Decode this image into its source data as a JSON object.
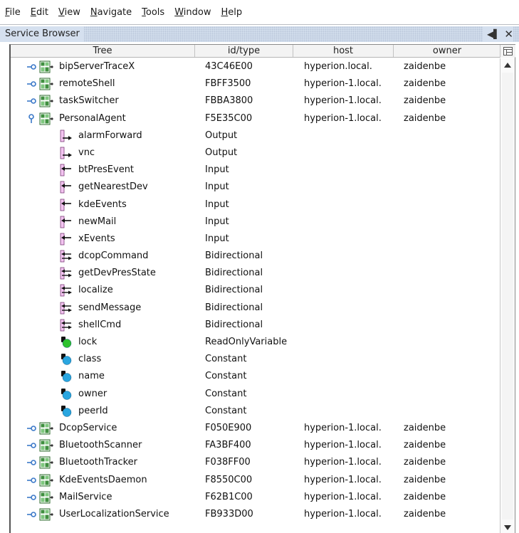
{
  "menu": [
    {
      "mnemonic": "F",
      "rest": "ile"
    },
    {
      "mnemonic": "E",
      "rest": "dit"
    },
    {
      "mnemonic": "V",
      "rest": "iew"
    },
    {
      "mnemonic": "N",
      "rest": "avigate"
    },
    {
      "mnemonic": "T",
      "rest": "ools"
    },
    {
      "mnemonic": "W",
      "rest": "indow"
    },
    {
      "mnemonic": "H",
      "rest": "elp"
    }
  ],
  "panel": {
    "title": "Service Browser",
    "controls": {
      "minimize": "◀▌",
      "close": "✕"
    }
  },
  "table": {
    "columns": [
      "Tree",
      "id/type",
      "host",
      "owner"
    ],
    "rows": [
      {
        "kind": "service",
        "expanded": false,
        "name": "bipServerTraceX",
        "id": "43C46E00",
        "host": "hyperion.local.",
        "owner": "zaidenbe"
      },
      {
        "kind": "service",
        "expanded": false,
        "name": "remoteShell",
        "id": "FBFF3500",
        "host": "hyperion-1.local.",
        "owner": "zaidenbe"
      },
      {
        "kind": "service",
        "expanded": false,
        "name": "taskSwitcher",
        "id": "FBBA3800",
        "host": "hyperion-1.local.",
        "owner": "zaidenbe"
      },
      {
        "kind": "service",
        "expanded": true,
        "name": "PersonalAgent",
        "id": "F5E35C00",
        "host": "hyperion-1.local.",
        "owner": "zaidenbe"
      },
      {
        "kind": "output",
        "name": "alarmForward",
        "id": "Output"
      },
      {
        "kind": "output",
        "name": "vnc",
        "id": "Output"
      },
      {
        "kind": "input",
        "name": "btPresEvent",
        "id": "Input"
      },
      {
        "kind": "input",
        "name": "getNearestDev",
        "id": "Input"
      },
      {
        "kind": "input",
        "name": "kdeEvents",
        "id": "Input"
      },
      {
        "kind": "input",
        "name": "newMail",
        "id": "Input"
      },
      {
        "kind": "input",
        "name": "xEvents",
        "id": "Input"
      },
      {
        "kind": "bidirectional",
        "name": "dcopCommand",
        "id": "Bidirectional"
      },
      {
        "kind": "bidirectional",
        "name": "getDevPresState",
        "id": "Bidirectional"
      },
      {
        "kind": "bidirectional",
        "name": "localize",
        "id": "Bidirectional"
      },
      {
        "kind": "bidirectional",
        "name": "sendMessage",
        "id": "Bidirectional"
      },
      {
        "kind": "bidirectional",
        "name": "shellCmd",
        "id": "Bidirectional"
      },
      {
        "kind": "variable",
        "name": "lock",
        "id": "ReadOnlyVariable"
      },
      {
        "kind": "constant",
        "name": "class",
        "id": "Constant"
      },
      {
        "kind": "constant",
        "name": "name",
        "id": "Constant"
      },
      {
        "kind": "constant",
        "name": "owner",
        "id": "Constant"
      },
      {
        "kind": "constant",
        "name": "peerId",
        "id": "Constant"
      },
      {
        "kind": "service",
        "expanded": false,
        "name": "DcopService",
        "id": "F050E900",
        "host": "hyperion-1.local.",
        "owner": "zaidenbe"
      },
      {
        "kind": "service",
        "expanded": false,
        "name": "BluetoothScanner",
        "id": "FA3BF400",
        "host": "hyperion-1.local.",
        "owner": "zaidenbe"
      },
      {
        "kind": "service",
        "expanded": false,
        "name": "BluetoothTracker",
        "id": "F038FF00",
        "host": "hyperion-1.local.",
        "owner": "zaidenbe"
      },
      {
        "kind": "service",
        "expanded": false,
        "name": "KdeEventsDaemon",
        "id": "F8550C00",
        "host": "hyperion-1.local.",
        "owner": "zaidenbe"
      },
      {
        "kind": "service",
        "expanded": false,
        "name": "MailService",
        "id": "F62B1C00",
        "host": "hyperion-1.local.",
        "owner": "zaidenbe"
      },
      {
        "kind": "service",
        "expanded": false,
        "name": "UserLocalizationService",
        "id": "FB933D00",
        "host": "hyperion-1.local.",
        "owner": "zaidenbe"
      }
    ]
  },
  "colors": {
    "variable_dot": "#2ec22e",
    "constant_dot": "#2aa6e0",
    "port_pink": "#f3c4f0",
    "service_green": "#3f8f3f",
    "toggle_blue": "#3a78c8",
    "title_bar": "#d5e0ef"
  }
}
